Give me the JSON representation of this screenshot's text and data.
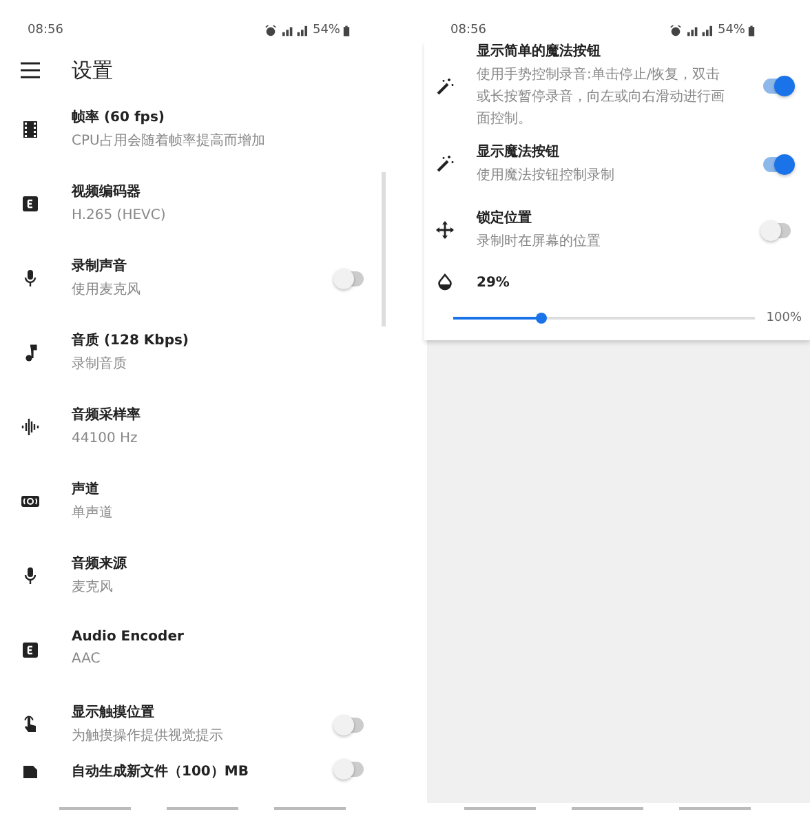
{
  "left_screen": {
    "status_bar": {
      "time": "08:56",
      "battery": "54%"
    },
    "app_bar": {
      "title": "设置"
    },
    "settings": [
      {
        "title": "帧率 (60 fps)",
        "subtitle": "CPU占用会随着帧率提高而增加",
        "kind": "plain"
      },
      {
        "title": "视频编码器",
        "subtitle": "H.265 (HEVC)",
        "kind": "plain"
      },
      {
        "title": "录制声音",
        "subtitle": "使用麦克风",
        "kind": "switch",
        "on": false
      },
      {
        "title": "音质 (128 Kbps)",
        "subtitle": "录制音质",
        "kind": "plain"
      },
      {
        "title": "音频采样率",
        "subtitle": "44100 Hz",
        "kind": "plain"
      },
      {
        "title": "声道",
        "subtitle": "单声道",
        "kind": "plain"
      },
      {
        "title": "音频来源",
        "subtitle": "麦克风",
        "kind": "plain"
      },
      {
        "title": "Audio Encoder",
        "subtitle": "AAC",
        "kind": "plain"
      },
      {
        "title": "显示触摸位置",
        "subtitle": "为触摸操作提供视觉提示",
        "kind": "switch",
        "on": false
      },
      {
        "title": "自动生成新文件（100）MB",
        "kind": "switch",
        "on": false
      }
    ]
  },
  "right_screen": {
    "status_bar": {
      "time": "08:56",
      "battery": "54%"
    },
    "settings": [
      {
        "title": "显示简单的魔法按钮",
        "subtitle": "使用手势控制录音:单击停止/恢复，双击或长按暂停录音，向左或向右滑动进行画面控制。",
        "kind": "switch",
        "on": true
      },
      {
        "title": "显示魔法按钮",
        "subtitle": "使用魔法按钮控制录制",
        "kind": "switch",
        "on": true
      },
      {
        "title": "锁定位置",
        "subtitle": "录制时在屏幕的位置",
        "kind": "switch",
        "on": false
      }
    ],
    "opacity": {
      "value": "29%",
      "level": 0.29,
      "max_label": "100%"
    }
  }
}
